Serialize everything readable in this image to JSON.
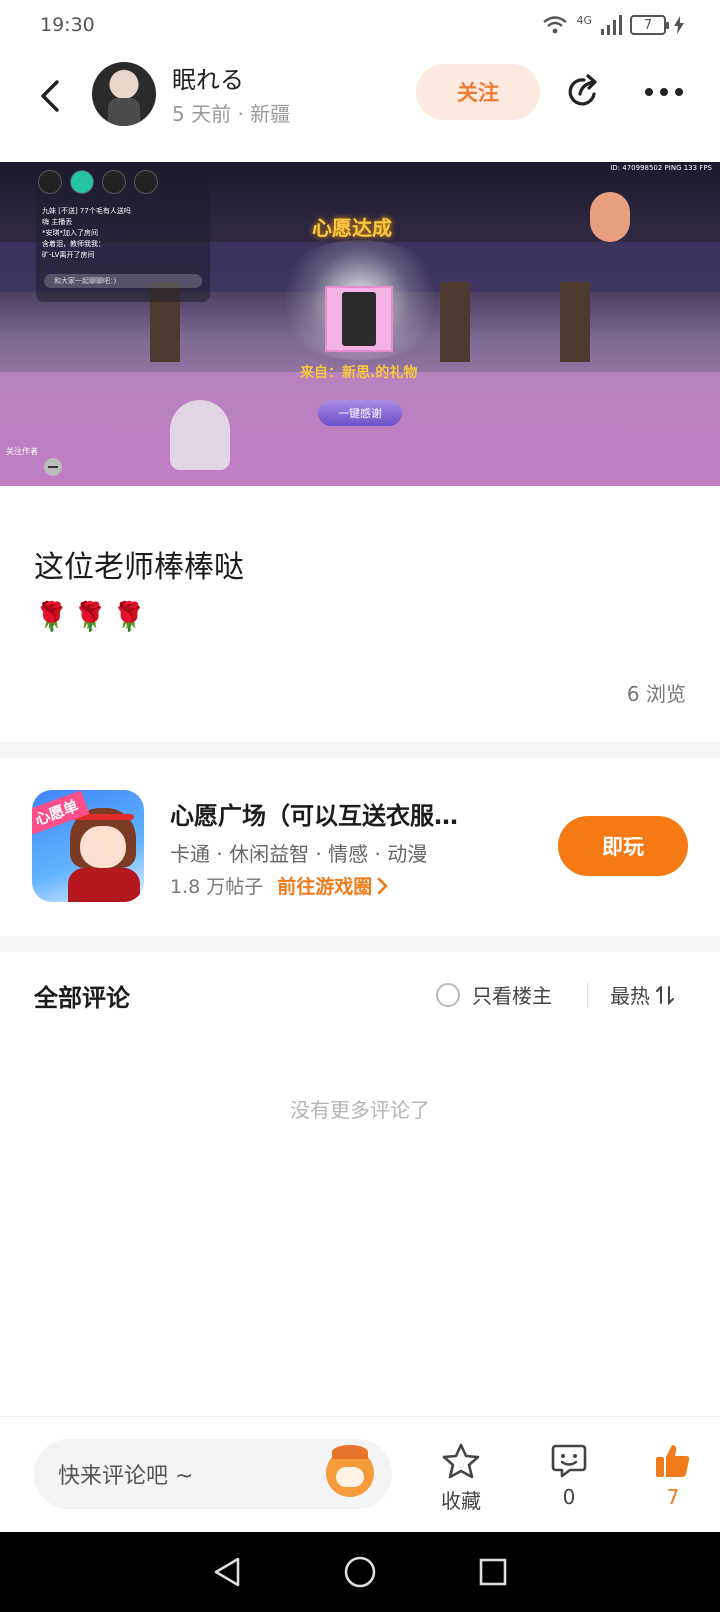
{
  "status_bar": {
    "time": "19:30",
    "network": "4G",
    "battery": "7"
  },
  "header": {
    "author_name": "眠れる",
    "author_meta": "5 天前 · 新疆",
    "follow_label": "关注"
  },
  "game_screenshot": {
    "title": "心愿达成",
    "from_text": "来自：新思.的礼物",
    "thanks_button": "一键感谢",
    "follow_author": "关注作者",
    "chat_lines": [
      "九妹 [不送] 77个毛有人送吗",
      "嗨 主播丢",
      "*安琪*加入了房间",
      "含着泪，教师我我：",
      "旷-LV离开了房间"
    ],
    "chat_placeholder": "和大家一起聊聊吧：)",
    "id_text": "ID: 470998502   PING 133   FPS"
  },
  "post": {
    "title": "这位老师棒棒哒",
    "roses": "🌹🌹🌹",
    "views": "6 浏览"
  },
  "game_card": {
    "icon_tag": "心愿单",
    "name": "心愿广场（可以互送衣服…",
    "tags": "卡通 · 休闲益智 · 情感 · 动漫",
    "posts": "1.8 万帖子",
    "link_label": "前往游戏圈",
    "play_label": "即玩"
  },
  "comments": {
    "title": "全部评论",
    "only_op_label": "只看楼主",
    "sort_label": "最热",
    "empty_text": "没有更多评论了"
  },
  "action_bar": {
    "input_placeholder": "快来评论吧 ~",
    "favorite_label": "收藏",
    "comment_count": "0",
    "like_count": "7"
  },
  "colors": {
    "accent": "#f57a14",
    "follow_bg": "#fde9e0",
    "like": "#f07b1b"
  }
}
